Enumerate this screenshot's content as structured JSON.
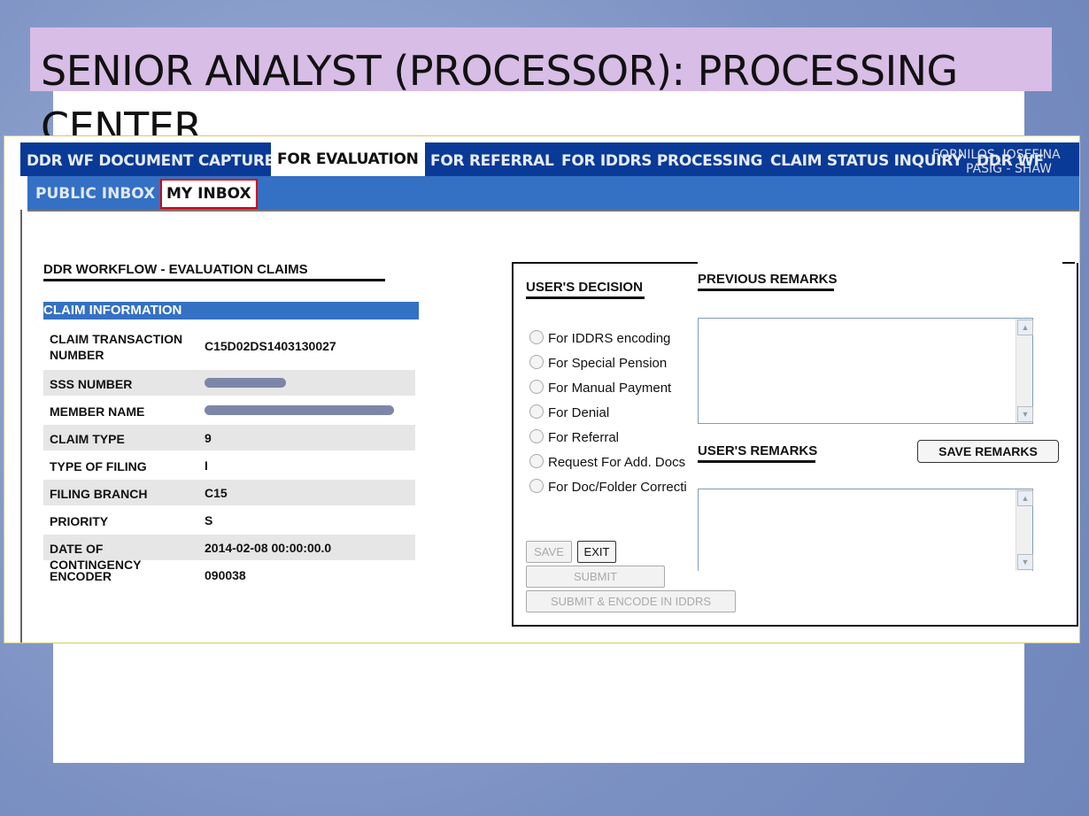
{
  "slide": {
    "title": "SENIOR ANALYST (PROCESSOR):  PROCESSING CENTER"
  },
  "nav": {
    "tabs": [
      "DDR WF DOCUMENT CAPTURE",
      "FOR EVALUATION",
      "FOR REFERRAL",
      "FOR IDDRS PROCESSING",
      "CLAIM STATUS INQUIRY",
      "DDR WF"
    ],
    "active_tab": "FOR EVALUATION",
    "user_name": "FORNILOS, JOSEFINA",
    "user_branch": "PASIG - SHAW",
    "subtabs": [
      "PUBLIC INBOX",
      "MY INBOX"
    ]
  },
  "left": {
    "heading": "DDR WORKFLOW - EVALUATION CLAIMS",
    "section": "CLAIM INFORMATION",
    "rows": [
      {
        "k": "CLAIM TRANSACTION NUMBER",
        "v": "C15D02DS1403130027"
      },
      {
        "k": "SSS NUMBER",
        "v": ""
      },
      {
        "k": "MEMBER NAME",
        "v": ""
      },
      {
        "k": "CLAIM TYPE",
        "v": "9"
      },
      {
        "k": "TYPE OF FILING",
        "v": "I"
      },
      {
        "k": "FILING BRANCH",
        "v": "C15"
      },
      {
        "k": "PRIORITY",
        "v": "S"
      },
      {
        "k": "DATE OF CONTINGENCY",
        "v": "2014-02-08 00:00:00.0"
      },
      {
        "k": "ENCODER",
        "v": "090038"
      }
    ]
  },
  "decision": {
    "heading": "USER'S DECISION",
    "options": [
      "For IDDRS encoding",
      "For Special Pension",
      "For Manual Payment",
      "For Denial",
      "For Referral",
      "Request For Add. Docs",
      "For Doc/Folder Correcti"
    ],
    "save": "SAVE",
    "exit": "EXIT",
    "submit": "SUBMIT",
    "submit_encode": "SUBMIT & ENCODE IN IDDRS"
  },
  "remarks": {
    "previous": "PREVIOUS REMARKS",
    "user": "USER'S REMARKS",
    "save_remarks": "SAVE REMARKS"
  },
  "colors": {
    "nav_dark": "#0a3a97",
    "nav_light": "#3470c4",
    "title_band": "#d8bde6"
  }
}
